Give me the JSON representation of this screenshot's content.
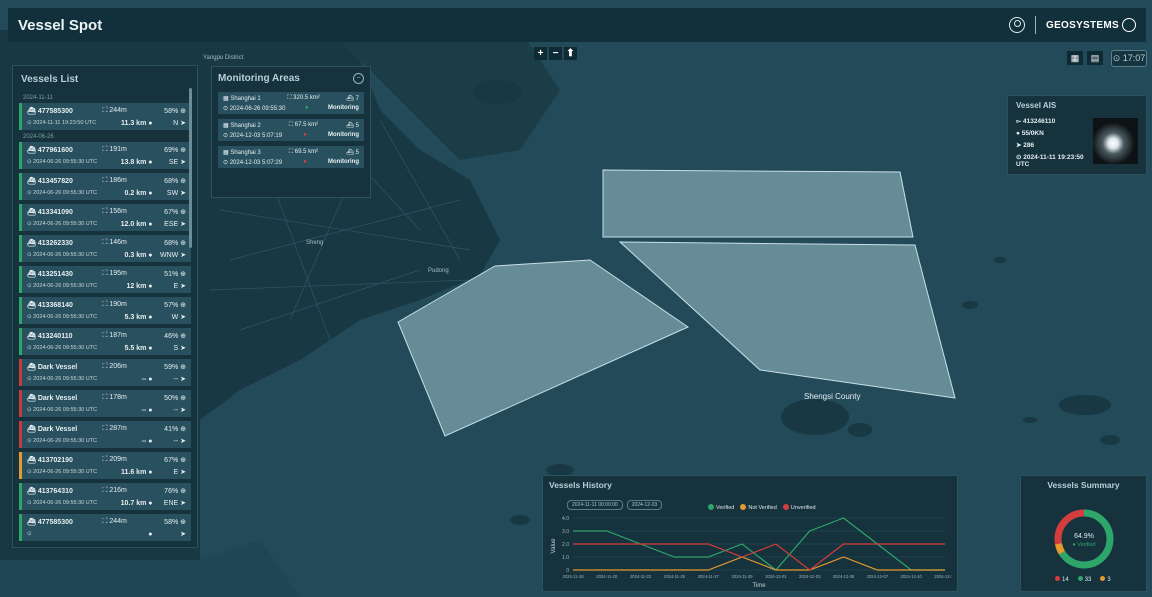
{
  "app": {
    "title": "Vessel Spot",
    "brand": "GEOSYSTEMS"
  },
  "map": {
    "labels": [
      "Yangpu District",
      "Shengsi County",
      "Sheng",
      "Pudong"
    ],
    "zoom_in": "+",
    "zoom_out": "−",
    "compass": "⬆",
    "clock": "17:07"
  },
  "vessels_list": {
    "title": "Vessels List",
    "sections": [
      {
        "date": "2024-11-11",
        "items": [
          {
            "name": "477585300",
            "length": "244m",
            "pct": "58%",
            "time": "2024-11-11 19:23:50 UTC",
            "dist": "11.3 km",
            "dir": "N",
            "status": "green"
          }
        ]
      },
      {
        "date": "2024-06-26",
        "items": [
          {
            "name": "477961600",
            "length": "191m",
            "pct": "69%",
            "time": "2024-06-26 09:55:30 UTC",
            "dist": "13.8 km",
            "dir": "SE",
            "status": "green"
          },
          {
            "name": "413457820",
            "length": "186m",
            "pct": "68%",
            "time": "2024-06-26 09:55:30 UTC",
            "dist": "0.2 km",
            "dir": "SW",
            "status": "green"
          },
          {
            "name": "413341090",
            "length": "156m",
            "pct": "67%",
            "time": "2024-06-26 09:55:30 UTC",
            "dist": "12.0 km",
            "dir": "ESE",
            "status": "green"
          },
          {
            "name": "413262330",
            "length": "146m",
            "pct": "68%",
            "time": "2024-06-26 09:55:30 UTC",
            "dist": "0.3 km",
            "dir": "WNW",
            "status": "green"
          },
          {
            "name": "413251430",
            "length": "195m",
            "pct": "51%",
            "time": "2024-06-26 09:55:30 UTC",
            "dist": "12 km",
            "dir": "E",
            "status": "green"
          },
          {
            "name": "413368140",
            "length": "190m",
            "pct": "57%",
            "time": "2024-06-26 09:55:30 UTC",
            "dist": "5.3 km",
            "dir": "W",
            "status": "green"
          },
          {
            "name": "413240110",
            "length": "187m",
            "pct": "46%",
            "time": "2024-06-26 09:55:30 UTC",
            "dist": "5.5 km",
            "dir": "S",
            "status": "green"
          },
          {
            "name": "Dark Vessel",
            "length": "206m",
            "pct": "59%",
            "time": "2024-06-26 09:55:30 UTC",
            "dist": "--",
            "dir": "--",
            "status": "red"
          },
          {
            "name": "Dark Vessel",
            "length": "178m",
            "pct": "50%",
            "time": "2024-06-26 09:55:30 UTC",
            "dist": "--",
            "dir": "--",
            "status": "red"
          },
          {
            "name": "Dark Vessel",
            "length": "287m",
            "pct": "41%",
            "time": "2024-06-26 09:55:30 UTC",
            "dist": "--",
            "dir": "--",
            "status": "red"
          },
          {
            "name": "413702190",
            "length": "209m",
            "pct": "67%",
            "time": "2024-06-26 09:55:30 UTC",
            "dist": "11.6 km",
            "dir": "E",
            "status": "amber"
          },
          {
            "name": "413764310",
            "length": "216m",
            "pct": "76%",
            "time": "2024-06-26 09:55:30 UTC",
            "dist": "10.7 km",
            "dir": "ENE",
            "status": "green"
          },
          {
            "name": "477585300",
            "length": "244m",
            "pct": "58%",
            "time": "",
            "dist": "",
            "dir": "",
            "status": "green"
          }
        ]
      }
    ]
  },
  "monitoring_areas": {
    "title": "Monitoring Areas",
    "items": [
      {
        "name": "Shanghai 1",
        "area": "320.5 km²",
        "count": "7",
        "time": "2024-06-26 09:55:30",
        "status": "Monitoring",
        "dot": "green"
      },
      {
        "name": "Shanghai 2",
        "area": "67.5 km²",
        "count": "5",
        "time": "2024-12-03 5:07:19",
        "status": "Monitoring",
        "dot": "red"
      },
      {
        "name": "Shanghai 3",
        "area": "69.5 km²",
        "count": "5",
        "time": "2024-12-03 5:07:29",
        "status": "Monitoring",
        "dot": "red"
      }
    ]
  },
  "vessel_ais": {
    "title": "Vessel AIS",
    "mmsi": "413246110",
    "heading": "55/0KN",
    "course": "286",
    "timestamp": "2024-11-11 19:23:50 UTC"
  },
  "vessels_history": {
    "title": "Vessels History",
    "filter_from": "2024-11-11 00:00:00",
    "filter_to": "2024-12-03",
    "legend": [
      {
        "label": "Verified",
        "color": "#2ea66a"
      },
      {
        "label": "Not Verified",
        "color": "#e59a2f"
      },
      {
        "label": "Unverified",
        "color": "#d43d3d"
      }
    ],
    "ylabel": "Value",
    "xlabel": "Time"
  },
  "chart_data": {
    "type": "line",
    "x": [
      "2024-11-18",
      "2024-11-20",
      "2024-11-22",
      "2024-11-25",
      "2024-11-27",
      "2024-11-29",
      "2024-12-01",
      "2024-12-03",
      "2024-12-05",
      "2024-12-07",
      "2024-12-10",
      "2024-12-12"
    ],
    "series": [
      {
        "name": "Verified",
        "color": "#2ea66a",
        "values": [
          3,
          3,
          2,
          1,
          1,
          2,
          0,
          3,
          4,
          2,
          0,
          0
        ]
      },
      {
        "name": "Not Verified",
        "color": "#e59a2f",
        "values": [
          0,
          0,
          0,
          0,
          0,
          1,
          0,
          0,
          1,
          0,
          0,
          0
        ]
      },
      {
        "name": "Unverified",
        "color": "#d43d3d",
        "values": [
          2,
          2,
          2,
          2,
          2,
          1,
          2,
          0,
          2,
          2,
          2,
          2
        ]
      }
    ],
    "yticks": [
      "0",
      "1.0",
      "2.0",
      "3.0",
      "4.0"
    ],
    "ylim": [
      0,
      4
    ],
    "xlabel": "Time",
    "ylabel": "Value"
  },
  "vessels_summary": {
    "title": "Vessels Summary",
    "pct": "64.9%",
    "pct_label": "Verified",
    "counts": [
      {
        "label": "14",
        "color": "#d43d3d",
        "value": 14
      },
      {
        "label": "33",
        "color": "#2ea66a",
        "value": 33
      },
      {
        "label": "3",
        "color": "#e59a2f",
        "value": 3
      }
    ]
  }
}
